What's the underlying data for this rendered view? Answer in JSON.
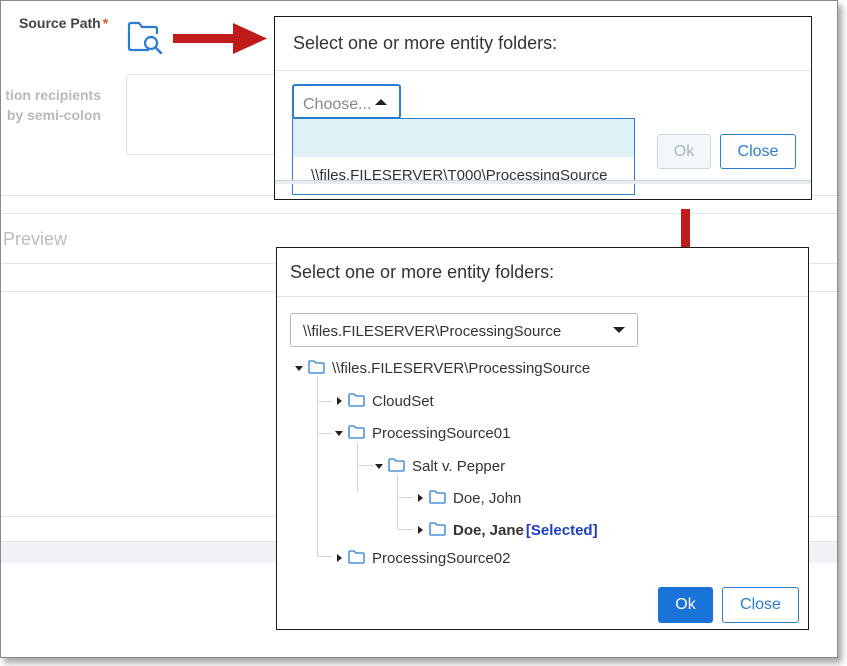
{
  "background": {
    "source_path_label": "Source Path",
    "required_mark": "*",
    "recipients_line1": "tion recipients",
    "recipients_line2": "by semi-colon",
    "preview_label": "Preview"
  },
  "dialog_picker": {
    "title": "Select one or more entity folders:",
    "choose_placeholder": "Choose...",
    "dropdown_options": [
      "",
      "\\\\files.FILESERVER\\T000\\ProcessingSource"
    ],
    "ok_label": "Ok",
    "close_label": "Close"
  },
  "dialog_tree": {
    "title": "Select one or more entity folders:",
    "selected_source": "\\\\files.FILESERVER\\ProcessingSource",
    "tree": {
      "root": "\\\\files.FILESERVER\\ProcessingSource",
      "cloudset": "CloudSet",
      "ps01": "ProcessingSource01",
      "salt": "Salt v. Pepper",
      "doe_john": "Doe, John",
      "doe_jane": "Doe, Jane",
      "selected_tag": "[Selected]",
      "ps02": "ProcessingSource02"
    },
    "ok_label": "Ok",
    "close_label": "Close"
  },
  "colors": {
    "accent": "#2b7cd3",
    "primary_button": "#1a73d9",
    "arrow": "#c01a1a",
    "selected_tag": "#1f3fc4",
    "dropdown_highlight": "#dff1f7"
  },
  "icons": [
    "folder-search-icon",
    "folder-icon",
    "caret-up-icon",
    "caret-down-icon",
    "expand-arrow-icon",
    "collapse-arrow-icon",
    "red-arrow-right",
    "red-arrow-down"
  ]
}
